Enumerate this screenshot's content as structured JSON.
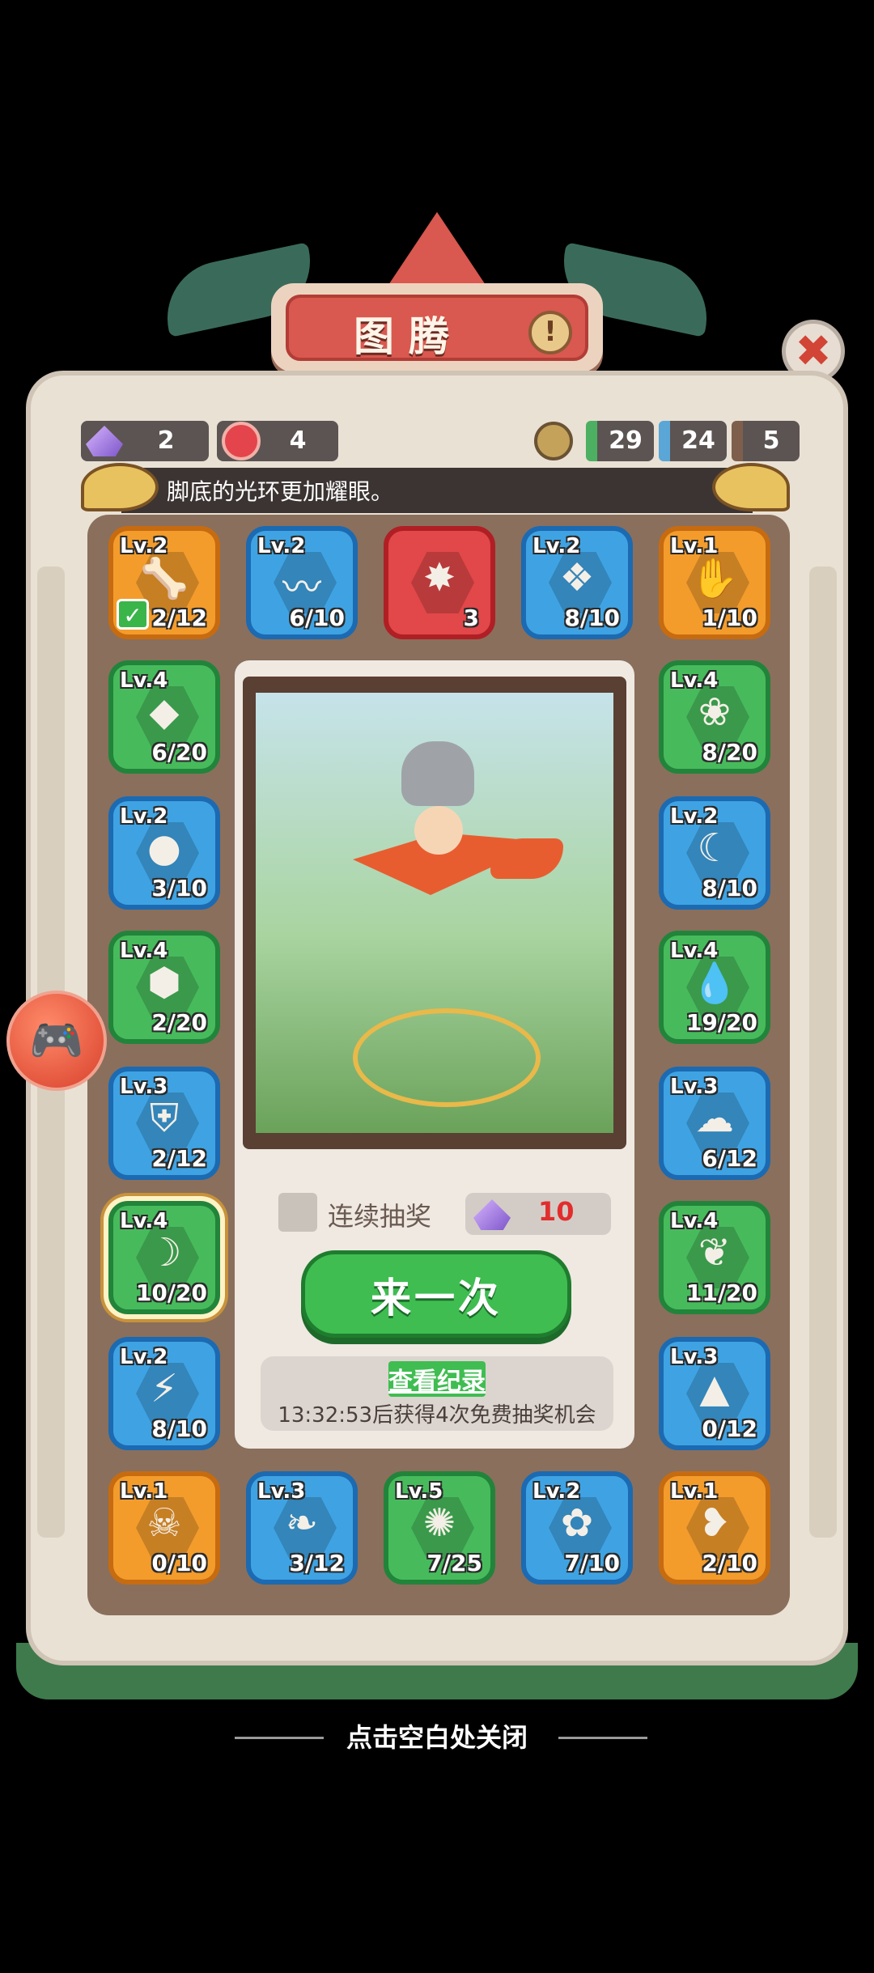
{
  "header": {
    "title": "图腾",
    "info_icon": "!",
    "close_icon": "✖"
  },
  "resources": {
    "crystals": "2",
    "gems": "4",
    "medal_counts": [
      "29",
      "24",
      "5"
    ],
    "colors": {
      "green": "#4caf61",
      "blue": "#5aa6d6",
      "brown": "#7e5f4c"
    }
  },
  "message": "脚底的光环更加耀眼。",
  "tiles": [
    {
      "color": "orange",
      "lv": "Lv.2",
      "count": "2/12",
      "icon": "fang-icon",
      "glyph": "🦴",
      "checked": true
    },
    {
      "color": "blue",
      "lv": "Lv.2",
      "count": "6/10",
      "icon": "tornado-icon",
      "glyph": "〰"
    },
    {
      "color": "red",
      "lv": "",
      "count": "3",
      "icon": "compass-star-icon",
      "glyph": "✸"
    },
    {
      "color": "blue",
      "lv": "Lv.2",
      "count": "8/10",
      "icon": "tooth-icon",
      "glyph": "❖"
    },
    {
      "color": "orange",
      "lv": "Lv.1",
      "count": "1/10",
      "icon": "claw-icon",
      "glyph": "✋"
    },
    {
      "color": "green",
      "lv": "Lv.4",
      "count": "6/20",
      "icon": "rock-icon",
      "glyph": "◆"
    },
    {
      "color": "green",
      "lv": "Lv.4",
      "count": "8/20",
      "icon": "shell-icon",
      "glyph": "❀"
    },
    {
      "color": "blue",
      "lv": "Lv.2",
      "count": "3/10",
      "icon": "egg-icon",
      "glyph": "●"
    },
    {
      "color": "blue",
      "lv": "Lv.2",
      "count": "8/10",
      "icon": "moon-icon",
      "glyph": "☾"
    },
    {
      "color": "green",
      "lv": "Lv.4",
      "count": "2/20",
      "icon": "honeycomb-icon",
      "glyph": "⬢"
    },
    {
      "color": "green",
      "lv": "Lv.4",
      "count": "19/20",
      "icon": "drop-icon",
      "glyph": "💧"
    },
    {
      "color": "blue",
      "lv": "Lv.3",
      "count": "2/12",
      "icon": "armor-icon",
      "glyph": "⛨"
    },
    {
      "color": "blue",
      "lv": "Lv.3",
      "count": "6/12",
      "icon": "stone-icon",
      "glyph": "☁"
    },
    {
      "color": "green",
      "lv": "Lv.4",
      "count": "10/20",
      "icon": "horn-icon",
      "glyph": "☽",
      "selected": true
    },
    {
      "color": "green",
      "lv": "Lv.4",
      "count": "11/20",
      "icon": "feather-icon",
      "glyph": "❦"
    },
    {
      "color": "blue",
      "lv": "Lv.2",
      "count": "8/10",
      "icon": "lightning-icon",
      "glyph": "⚡"
    },
    {
      "color": "blue",
      "lv": "Lv.3",
      "count": "0/12",
      "icon": "mountain-icon",
      "glyph": "▲"
    },
    {
      "color": "orange",
      "lv": "Lv.1",
      "count": "0/10",
      "icon": "skull-icon",
      "glyph": "☠"
    },
    {
      "color": "blue",
      "lv": "Lv.3",
      "count": "3/12",
      "icon": "leaf-icon",
      "glyph": "❧"
    },
    {
      "color": "green",
      "lv": "Lv.5",
      "count": "7/25",
      "icon": "fossil-icon",
      "glyph": "✺"
    },
    {
      "color": "blue",
      "lv": "Lv.2",
      "count": "7/10",
      "icon": "bone-icon",
      "glyph": "✿"
    },
    {
      "color": "orange",
      "lv": "Lv.1",
      "count": "2/10",
      "icon": "ginkgo-icon",
      "glyph": "❥"
    }
  ],
  "draw": {
    "continuous_label": "连续抽奖",
    "cost": "10",
    "button_label": "来一次",
    "log_link": "查看纪录",
    "timer_text": "13:32:53后获得4次免费抽奖机会"
  },
  "side_button": {
    "icon": "gamepad-icon",
    "glyph": "🎮"
  },
  "footer_hint": "点击空白处关闭"
}
